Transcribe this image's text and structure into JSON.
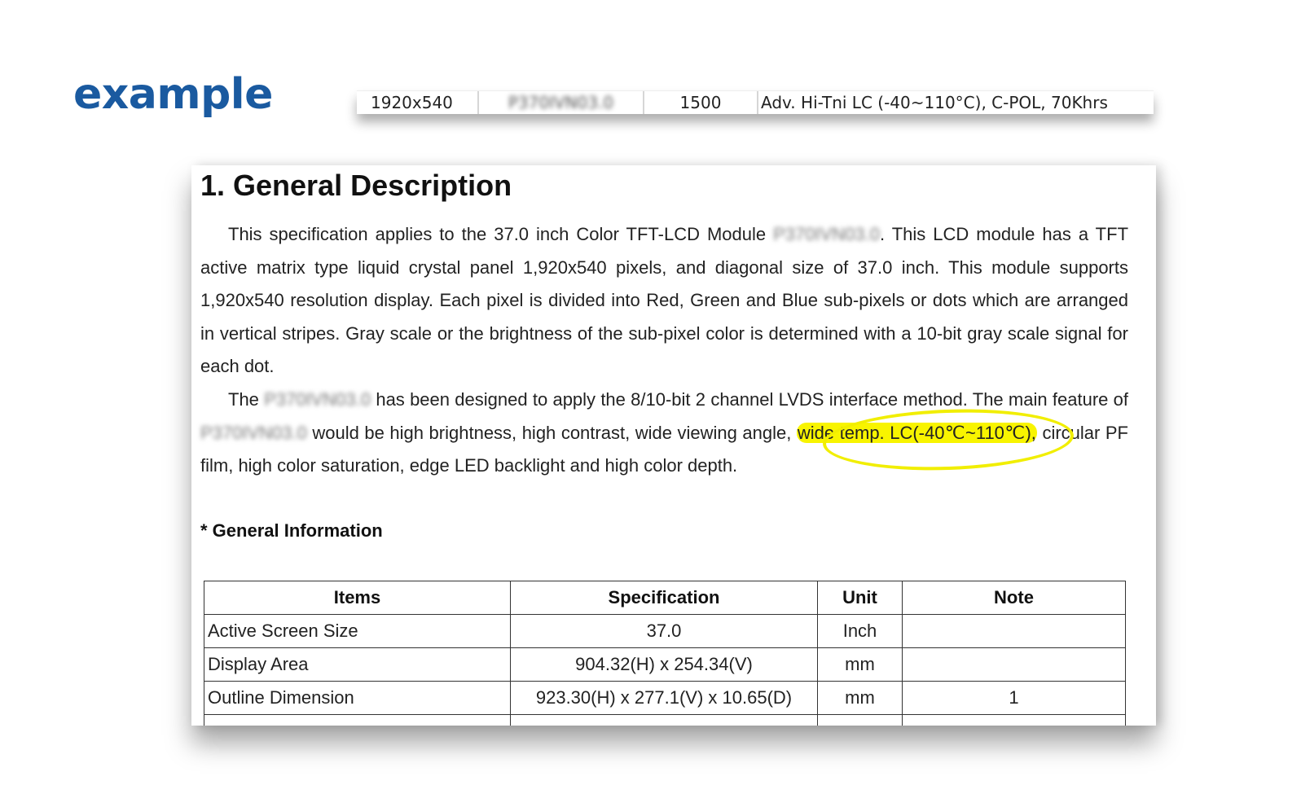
{
  "label": "example",
  "strip": {
    "resolution": "1920x540",
    "model": "P370IVN03.0",
    "brightness": "1500",
    "features": "Adv. Hi-Tni LC (-40~110°C), C-POL, 70Khrs"
  },
  "document": {
    "heading": "1. General Description",
    "p1_text_a": "This specification applies to the 37.0 inch Color TFT-LCD Module ",
    "p1_model": "P370IVN03.0",
    "p1_text_b": ". This LCD module has a TFT active matrix type liquid crystal panel 1,920x540 pixels, and diagonal size of 37.0 inch. This module supports 1,920x540 resolution display. Each pixel is divided into Red, Green and Blue sub-pixels or dots which are arranged in vertical stripes. Gray scale or the brightness of the sub-pixel color is determined with a 10-bit gray scale signal for each dot.",
    "p2_text_a": "The ",
    "p2_model_a": "P370IVN03.0",
    "p2_text_b": " has been designed to apply the 8/10-bit 2 channel LVDS interface method. The main feature of ",
    "p2_model_b": "P370IVN03.0",
    "p2_text_c": " would be high brightness, high contrast, wide viewing angle, ",
    "p2_highlight": "wide temp. LC(-40℃~110℃),",
    "p2_text_d": " circular PF film, high color saturation, edge LED backlight and high color depth.",
    "subheading": "* General Information",
    "table": {
      "headers": [
        "Items",
        "Specification",
        "Unit",
        "Note"
      ],
      "rows": [
        [
          "Active Screen Size",
          "37.0",
          "Inch",
          ""
        ],
        [
          "Display Area",
          "904.32(H) x 254.34(V)",
          "mm",
          ""
        ],
        [
          "Outline Dimension",
          "923.30(H) x 277.1(V) x 10.65(D)",
          "mm",
          "1"
        ]
      ]
    }
  },
  "colors": {
    "brand_blue": "#1a5aa0",
    "highlight_yellow": "#f8f400"
  }
}
